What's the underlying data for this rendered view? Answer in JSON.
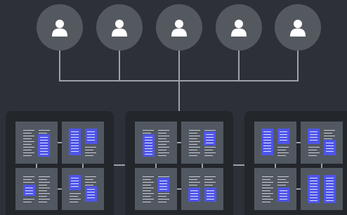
{
  "theme": {
    "background": "#2d3038",
    "avatar_fill": "#545960",
    "avatar_icon": "#ffffff",
    "connector": "#9da1a8",
    "panel": "#23262b",
    "card": "#525861",
    "text_line": "#c9ccd2",
    "accent_block": "#4e55e8"
  },
  "users": [
    {
      "icon": "person-icon"
    },
    {
      "icon": "person-icon"
    },
    {
      "icon": "person-icon"
    },
    {
      "icon": "person-icon"
    },
    {
      "icon": "person-icon"
    }
  ],
  "groups": [
    {
      "cards": [
        {
          "block": "right-tall"
        },
        {
          "block": "both-tall"
        },
        {
          "block": "left-small"
        },
        {
          "block": "two-small"
        }
      ]
    },
    {
      "cards": [
        {
          "block": "left-tall"
        },
        {
          "block": "right-small"
        },
        {
          "block": "right-small"
        },
        {
          "block": "two-small-low"
        }
      ]
    },
    {
      "cards": [
        {
          "block": "both-tall"
        },
        {
          "block": "two-small"
        },
        {
          "block": "right-small-low"
        },
        {
          "block": "both-full"
        }
      ]
    }
  ]
}
